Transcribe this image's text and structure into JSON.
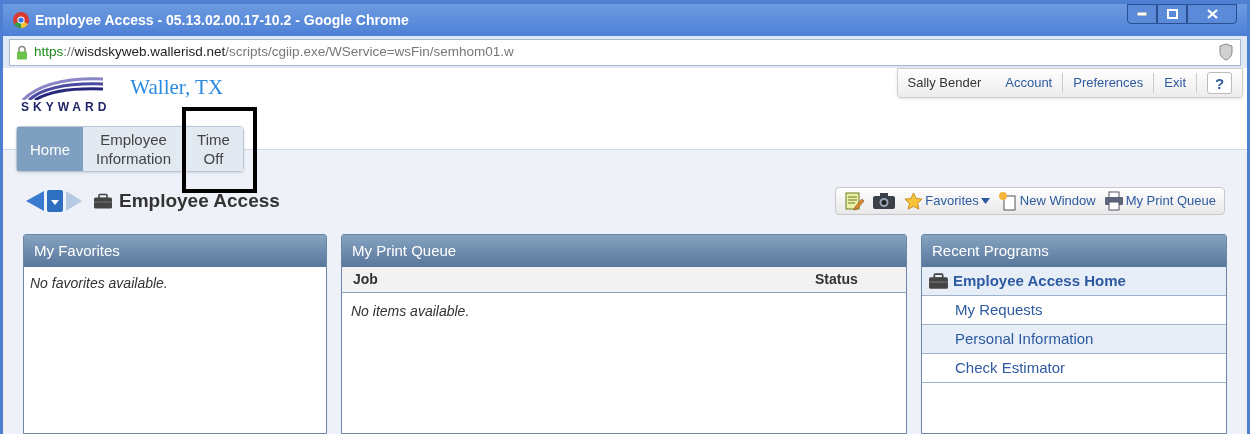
{
  "window": {
    "title": "Employee Access - 05.13.02.00.17-10.2 - Google Chrome"
  },
  "address_bar": {
    "url": [
      {
        "kind": "scheme",
        "text": "https"
      },
      {
        "kind": "path",
        "text": "://"
      },
      {
        "kind": "host",
        "text": "wisdskyweb.wallerisd.net"
      },
      {
        "kind": "path",
        "text": "/scripts/cgiip.exe/WService=wsFin/semhom01.w"
      }
    ]
  },
  "header": {
    "logo": "SKYWARD",
    "district": "Waller, TX",
    "user": "Sally Bender",
    "links": [
      "Account",
      "Preferences",
      "Exit"
    ],
    "help": "?"
  },
  "tabs": [
    {
      "lines": [
        "Home"
      ],
      "selected": true,
      "highlighted": false
    },
    {
      "lines": [
        "Employee",
        "Information"
      ],
      "selected": false,
      "highlighted": false
    },
    {
      "lines": [
        "Time",
        "Off"
      ],
      "selected": false,
      "highlighted": true
    }
  ],
  "page_title": "Employee Access",
  "toolbar": [
    {
      "kind": "notes"
    },
    {
      "kind": "camera"
    },
    {
      "kind": "favorites",
      "label": "Favorites"
    },
    {
      "kind": "new_window",
      "label": "New Window"
    },
    {
      "kind": "print",
      "label": "My Print Queue"
    }
  ],
  "panels": [
    {
      "kind": "message",
      "title": "My Favorites",
      "message": "No favorites available."
    },
    {
      "kind": "table",
      "title": "My Print Queue",
      "columns": [
        "Job",
        "Status"
      ],
      "message": "No items available."
    },
    {
      "kind": "list",
      "title": "Recent Programs",
      "items": [
        {
          "kind": "program",
          "label": "Employee Access Home"
        },
        {
          "kind": "link",
          "label": "My Requests"
        },
        {
          "kind": "link",
          "label": "Personal Information"
        },
        {
          "kind": "link",
          "label": "Check Estimator"
        }
      ]
    }
  ]
}
